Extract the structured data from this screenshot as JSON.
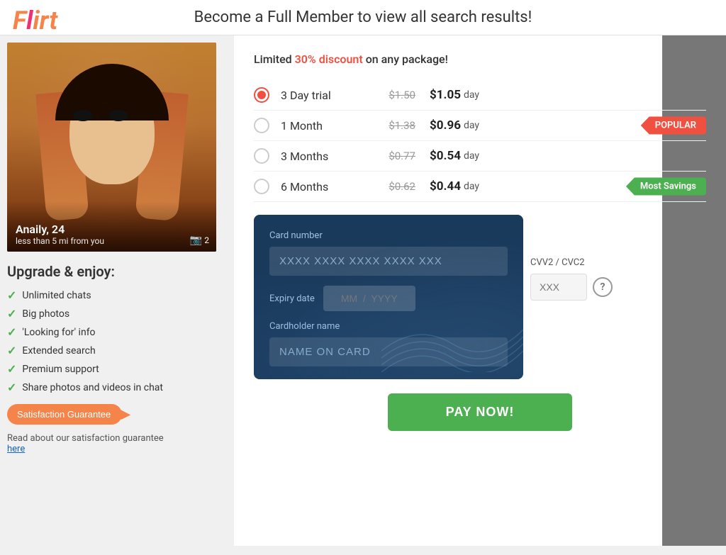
{
  "header": {
    "logo": "Flirt",
    "title": "Become a Full Member to view all search results!"
  },
  "profile": {
    "name": "Anaily, 24",
    "distance": "less than 5 mi from you",
    "photo_count": "2"
  },
  "upgrade": {
    "title": "Upgrade & enjoy:",
    "benefits": [
      "Unlimited chats",
      "Big photos",
      "'Looking for' info",
      "Extended search",
      "Premium support",
      "Share photos and videos in chat"
    ],
    "satisfaction_btn": "Satisfaction Guarantee",
    "guarantee_text": "Read about our satisfaction guarantee",
    "guarantee_link": "here"
  },
  "plans": {
    "discount_text": "Limited ",
    "discount_highlight": "30% discount",
    "discount_suffix": " on any package!",
    "items": [
      {
        "id": "3day",
        "name": "3 Day trial",
        "original_price": "$1.50",
        "current_price": "$1.05",
        "unit": "day",
        "selected": true,
        "badge": null
      },
      {
        "id": "1month",
        "name": "1 Month",
        "original_price": "$1.38",
        "current_price": "$0.96",
        "unit": "day",
        "selected": false,
        "badge": "POPULAR",
        "badge_type": "popular"
      },
      {
        "id": "3months",
        "name": "3 Months",
        "original_price": "$0.77",
        "current_price": "$0.54",
        "unit": "day",
        "selected": false,
        "badge": null
      },
      {
        "id": "6months",
        "name": "6 Months",
        "original_price": "$0.62",
        "current_price": "$0.44",
        "unit": "day",
        "selected": false,
        "badge": "Most Savings",
        "badge_type": "savings"
      }
    ]
  },
  "payment": {
    "card_number_label": "Card number",
    "card_number_placeholder": "XXXX XXXX XXXX XXXX XXX",
    "expiry_label": "Expiry date",
    "expiry_placeholder": "MM  /  YYYY",
    "cardholder_label": "Cardholder name",
    "cardholder_placeholder": "NAME ON CARD",
    "cvv_label": "CVV2 / CVC2",
    "cvv_placeholder": "XXX",
    "pay_button": "PAY NOW!"
  }
}
